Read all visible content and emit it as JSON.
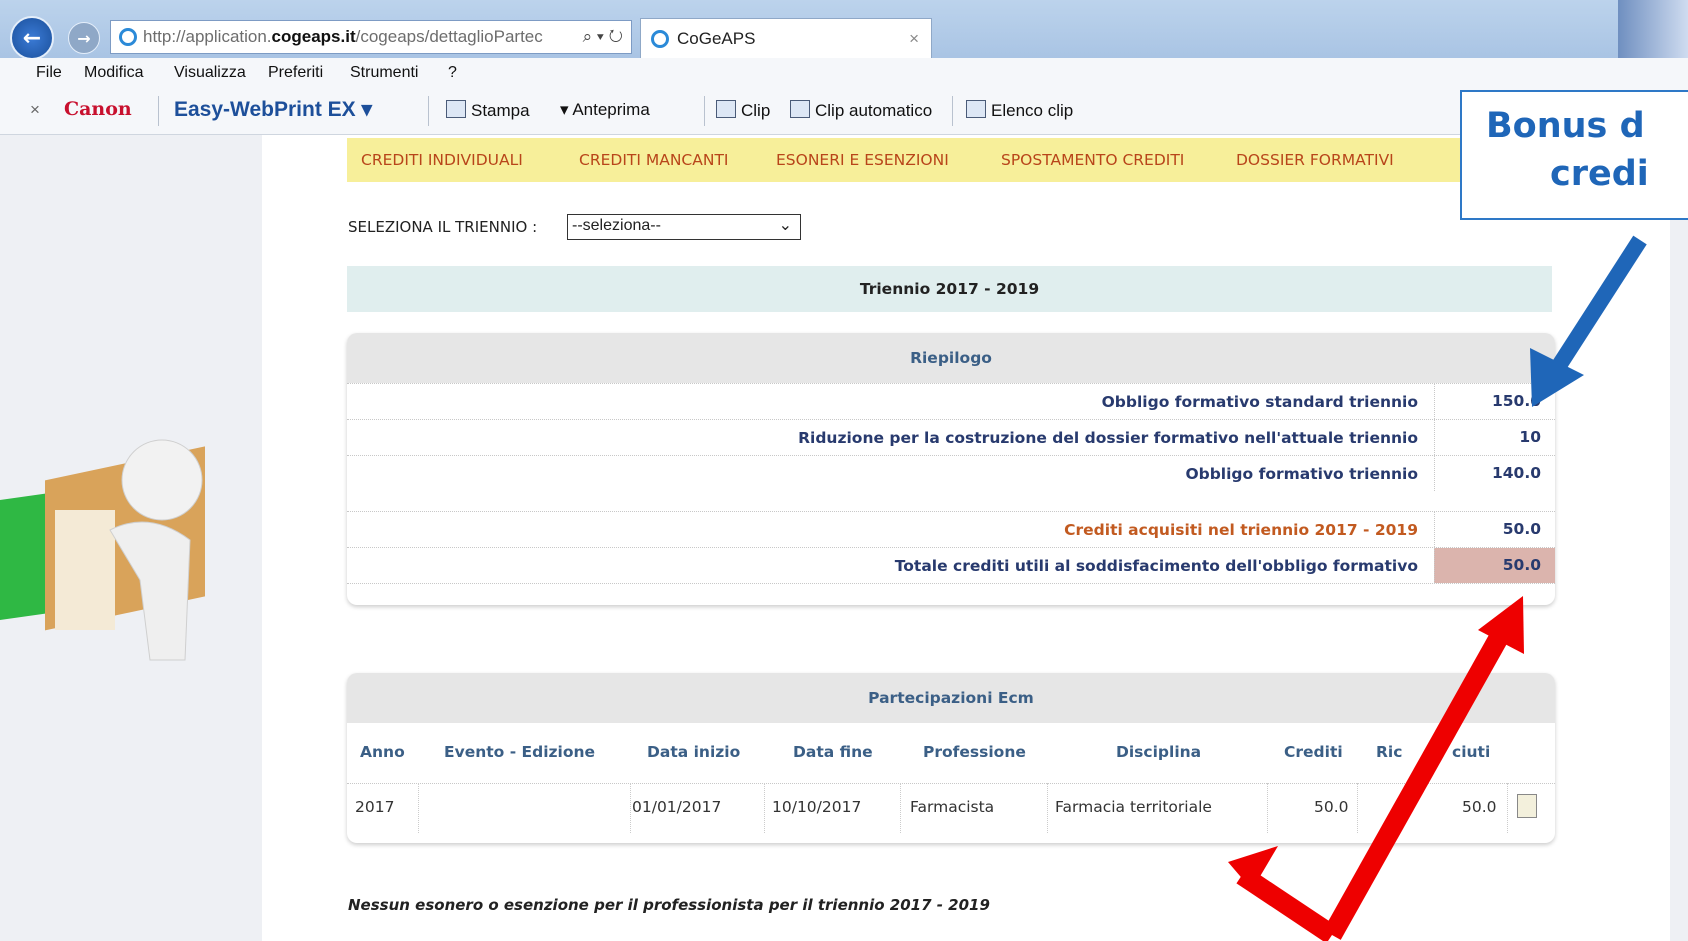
{
  "browser": {
    "url_prefix": "http://application.",
    "url_host": "cogeaps.it",
    "url_path": "/cogeaps/dettaglioPartec",
    "url_tools": "⌕ ▾ ↻",
    "tab_title": "CoGeAPS",
    "tab_close": "×",
    "back": "←",
    "forward": "→"
  },
  "menu": [
    "File",
    "Modifica",
    "Visualizza",
    "Preferiti",
    "Strumenti",
    "?"
  ],
  "toolbar": {
    "close": "×",
    "canon": "Canon",
    "easy": "Easy-WebPrint EX ▾",
    "stampa": "Stampa",
    "anteprima": "▾  Anteprima",
    "clip": "Clip",
    "clip_auto": "Clip automatico",
    "elenco_clip": "Elenco clip"
  },
  "nav": [
    "CREDITI INDIVIDUALI",
    "CREDITI MANCANTI",
    "ESONERI E ESENZIONI",
    "SPOSTAMENTO CREDITI",
    "DOSSIER FORMATIVI"
  ],
  "select": {
    "label": "SELEZIONA IL TRIENNIO :",
    "value": "--seleziona--",
    "chevron": "⌄"
  },
  "triennio_title": "Triennio 2017 - 2019",
  "riepilogo": {
    "title": "Riepilogo",
    "rows": [
      {
        "label": "Obbligo formativo standard triennio",
        "value": "150.0"
      },
      {
        "label": "Riduzione per la costruzione del dossier formativo nell'attuale triennio",
        "value": "10"
      },
      {
        "label": "Obbligo formativo triennio",
        "value": "140.0"
      },
      {
        "label": "Crediti acquisiti nel triennio 2017 - 2019",
        "value": "50.0"
      },
      {
        "label": "Totale crediti utili al soddisfacimento dell'obbligo formativo",
        "value": "50.0"
      }
    ]
  },
  "partecipazioni": {
    "title": "Partecipazioni Ecm",
    "columns": [
      "Anno",
      "Evento - Edizione",
      "Data inizio",
      "Data fine",
      "Professione",
      "Disciplina",
      "Crediti",
      "Ric",
      "ciuti"
    ],
    "row": {
      "anno": "2017",
      "evento": "",
      "data_inizio": "01/01/2017",
      "data_fine": "10/10/2017",
      "professione": "Farmacista",
      "disciplina": "Farmacia territoriale",
      "crediti": "50.0",
      "riconosciuti": "50.0"
    }
  },
  "note": "Nessun esonero o esenzione per il professionista per il triennio 2017 - 2019",
  "callout": {
    "line1": "Bonus d",
    "line2": "credi"
  },
  "colors": {
    "nav_bg": "#f7ef9a",
    "nav_text": "#b8451a",
    "highlight": "#dbb4ad",
    "arrow_blue": "#1f66b8",
    "arrow_red": "#ee0000"
  }
}
